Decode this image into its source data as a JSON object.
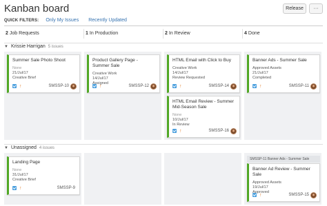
{
  "board": {
    "title": "Kanban board",
    "release_label": "Release",
    "more_label": "···"
  },
  "filters": {
    "label": "QUICK FILTERS:",
    "items": [
      "Only My Issues",
      "Recently Updated"
    ]
  },
  "columns": [
    {
      "count": "2",
      "name": "Job Requests"
    },
    {
      "count": "1",
      "name": "In Production"
    },
    {
      "count": "2",
      "name": "In Review"
    },
    {
      "count": "4",
      "name": "Done"
    }
  ],
  "swimlanes": [
    {
      "name": "Krissie Harrigan",
      "count": "5 issues"
    },
    {
      "name": "Unassigned",
      "count": "4 issues"
    }
  ],
  "cards": [
    {
      "title": "Summer Sale Photo Shoot",
      "f1": "None",
      "f2": "21/Jul/17",
      "f3": "Creative Brief",
      "key": "SMSSP-10"
    },
    {
      "title": "Product Gallery Page - Summer Sale",
      "f1": "Creative Work",
      "f2": "14/Jul/17",
      "f3": "Assigned",
      "key": "SMSSP-12"
    },
    {
      "title": "HTML Email with Click to Buy",
      "f1": "Creative Work",
      "f2": "14/Jul/17",
      "f3": "Review Requested",
      "key": "SMSSP-14"
    },
    {
      "title": "Banner Ads - Summer Sale",
      "f1": "Approved Assets",
      "f2": "21/Jul/17",
      "f3": "Completed",
      "key": "SMSSP-11"
    },
    {
      "title": "HTML Email Review - Summer Mid-Season Sale",
      "f1": "None",
      "f2": "10/Jul/17",
      "f3": "In Review",
      "key": "SMSSP-16"
    },
    {
      "title": "Landing Page",
      "f1": "None",
      "f2": "31/Jul/17",
      "f3": "Creative Brief",
      "key": "SMSSP-9"
    },
    {
      "title": "Banner Ad Review - Summer Sale",
      "f1": "Approved Assets",
      "f2": "19/Jul/17",
      "f3": "Approved",
      "key": "SMSSP-15"
    }
  ],
  "parent_tag": "SMSSP-11 Banner Ads - Summer Sale"
}
